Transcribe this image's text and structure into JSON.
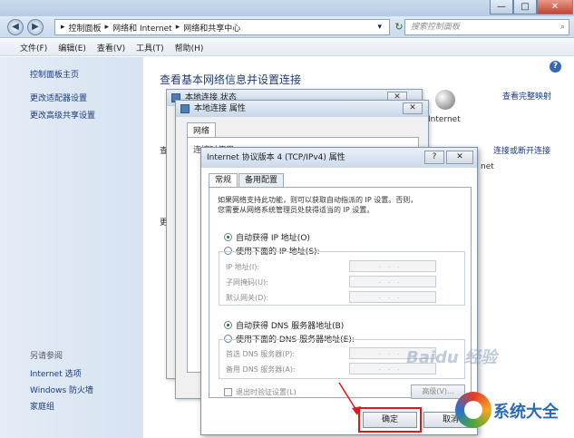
{
  "window": {
    "minimize": "—",
    "maximize": "□",
    "close": "✕"
  },
  "address": {
    "back": "◀",
    "forward": "▶",
    "crumbs": [
      "▸",
      "控制面板",
      "▸",
      "网络和 Internet",
      "▸",
      "网络和共享中心"
    ],
    "dropdown": "▾",
    "refresh": "↻",
    "search_placeholder": "搜索控制面板",
    "search_icon": "⌕"
  },
  "menu": [
    "文件(F)",
    "编辑(E)",
    "查看(V)",
    "工具(T)",
    "帮助(H)"
  ],
  "sidebar": {
    "links": [
      "控制面板主页",
      "更改适配器设置",
      "更改高级共享设置"
    ],
    "see_also_heading": "另请参阅",
    "see_also": [
      "Internet 选项",
      "Windows 防火墙",
      "家庭组"
    ]
  },
  "main": {
    "title": "查看基本网络信息并设置连接",
    "help": "?",
    "view_full_map": "查看完整映射",
    "internet_label": "Internet",
    "connect_or_disconnect": "连接或断开连接",
    "internet_label_2": "net",
    "side_fragments": [
      "查",
      "更"
    ]
  },
  "bg_dialogs": {
    "status_title": "本地连接 状态",
    "status_close": "✕",
    "props_title": "本地连接 属性",
    "props_close": "✕",
    "props_tab": "网络",
    "props_connect_fragment": "连接时使用"
  },
  "tcp_dialog": {
    "title": "Internet 协议版本 4 (TCP/IPv4) 属性",
    "help_btn": "?",
    "close_btn": "✕",
    "tabs": [
      "常规",
      "备用配置"
    ],
    "description": [
      "如果网络支持此功能，则可以获取自动指派的 IP 设置。否则，",
      "您需要从网络系统管理员处获得适当的 IP 设置。"
    ],
    "ip_auto": "自动获得 IP 地址(O)",
    "ip_manual": "使用下面的 IP 地址(S):",
    "ip_fields": [
      "IP 地址(I):",
      "子网掩码(U):",
      "默认网关(D):"
    ],
    "ip_placeholder": "...",
    "dns_auto": "自动获得 DNS 服务器地址(B)",
    "dns_manual": "使用下面的 DNS 服务器地址(E):",
    "dns_fields": [
      "首选 DNS 服务器(P):",
      "备用 DNS 服务器(A):"
    ],
    "validate_on_exit": "退出时验证设置(L)",
    "advanced": "高级(V)...",
    "ok": "确定",
    "cancel": "取消"
  },
  "watermarks": {
    "baidu": "Baidu 经验",
    "site": "系统大全"
  },
  "colors": {
    "highlight": "#e0181b",
    "link": "#1a3a7a"
  }
}
